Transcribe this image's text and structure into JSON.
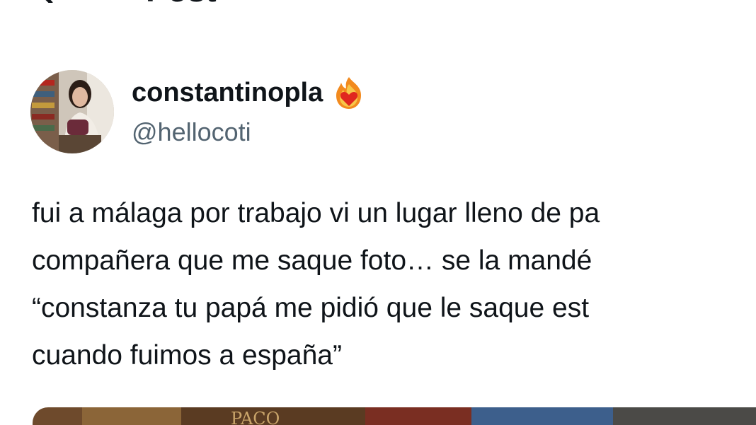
{
  "header": {
    "title": "Post",
    "back_icon": "arrow-left-icon"
  },
  "author": {
    "display_name": "constantinopla",
    "handle": "@hellocoti",
    "badge_icon": "flame-heart-icon",
    "avatar_icon": "avatar-photo"
  },
  "tweet": {
    "lines": [
      "fui a málaga por trabajo vi un lugar lleno de pa",
      "compañera que me saque foto… se la mandé",
      "“constanza tu papá me pidió que le saque est",
      "cuando fuimos a españa”"
    ]
  },
  "media": {
    "sign_text": "PACO"
  },
  "colors": {
    "text_primary": "#0f1419",
    "text_secondary": "#536471",
    "background": "#ffffff"
  }
}
